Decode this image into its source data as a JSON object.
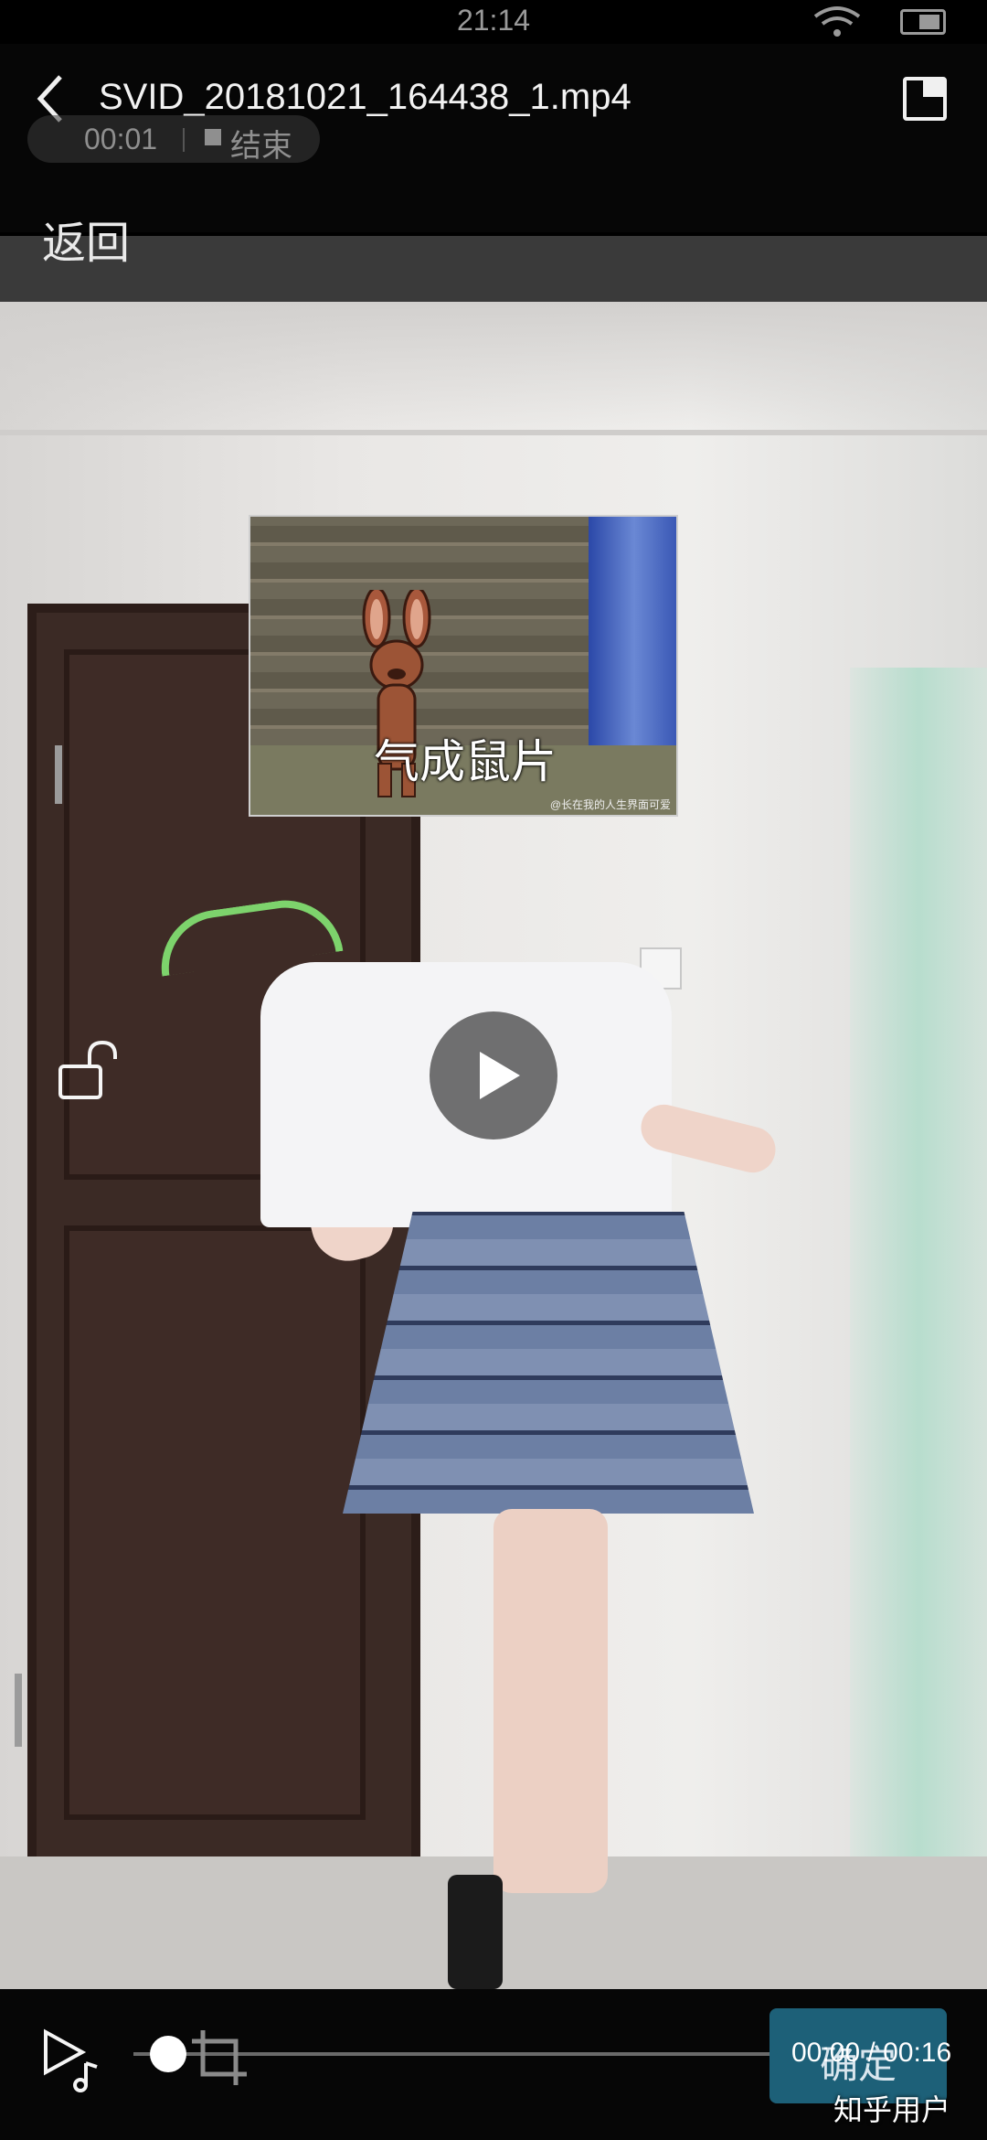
{
  "status_bar": {
    "time": "21:14",
    "wifi_icon": "wifi-icon",
    "battery_icon": "battery-icon"
  },
  "header": {
    "back_icon": "back-arrow-icon",
    "file_name": "SVID_20181021_164438_1.mp4",
    "pip_icon": "picture-in-picture-icon"
  },
  "recording": {
    "elapsed": "00:01",
    "stop_label": "结束"
  },
  "overlay": {
    "return_label": "返回"
  },
  "sticker": {
    "caption": "气成鼠片",
    "watermark": "@长在我的人生界面可爱"
  },
  "player": {
    "play_icon": "play-icon",
    "lock_icon": "unlock-icon",
    "playlist_icon": "playlist-icon",
    "crop_icon": "crop-icon",
    "confirm_label": "确定",
    "time_readout": "00:00 / 00:16",
    "progress": 0
  },
  "watermark": "知乎用户",
  "colors": {
    "accent": "#1d6078",
    "background": "#000000"
  }
}
